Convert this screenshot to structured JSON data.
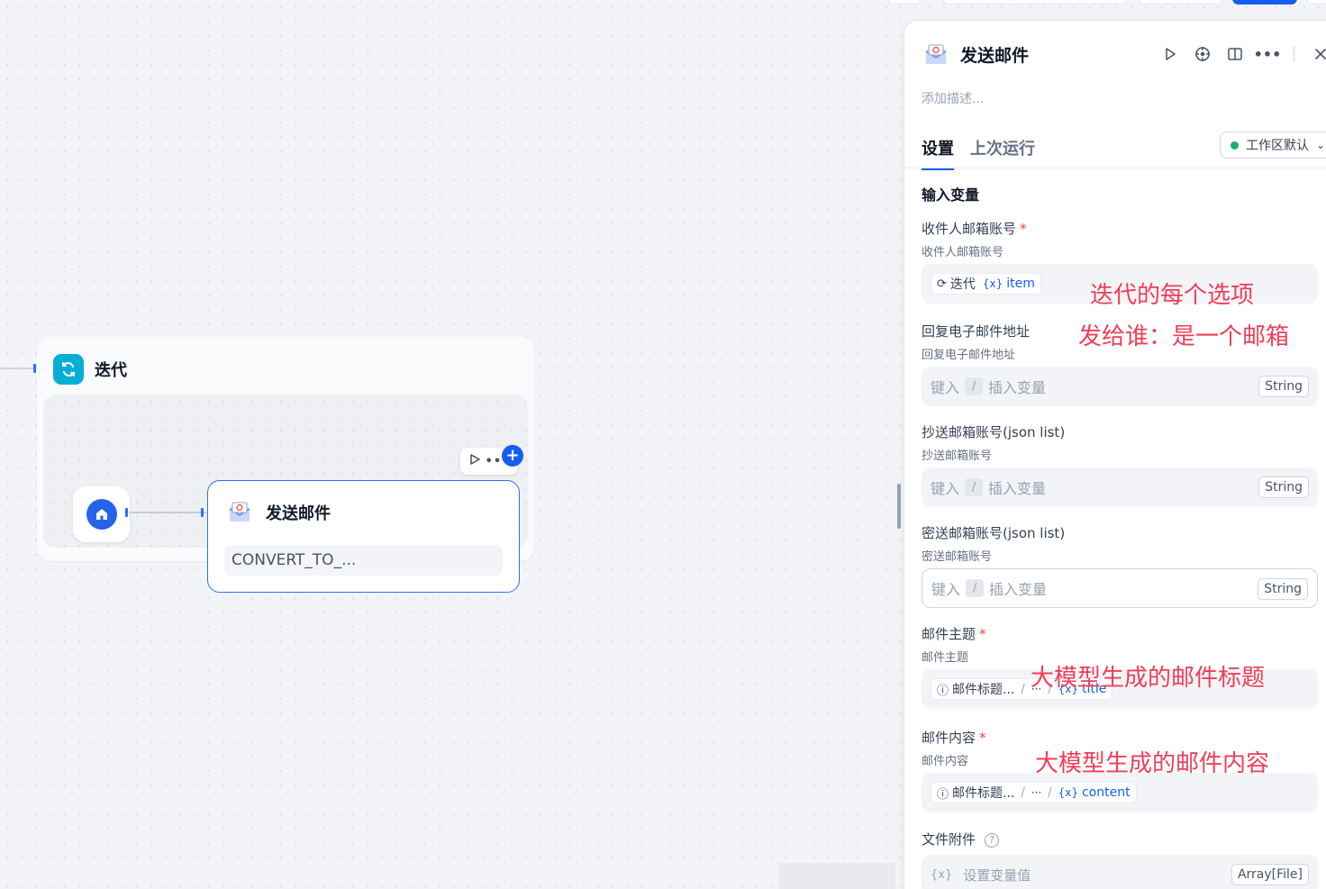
{
  "canvas": {
    "iteration_node": {
      "title": "迭代"
    },
    "mail_node": {
      "title": "发送邮件",
      "field_value": "CONVERT_TO_..."
    },
    "node_toolbar": {
      "run_icon": "play-icon",
      "more_icon": "more-icon"
    }
  },
  "panel": {
    "title": "发送邮件",
    "description_placeholder": "添加描述...",
    "tabs": [
      {
        "label": "设置",
        "active": true
      },
      {
        "label": "上次运行",
        "active": false
      }
    ],
    "workspace_select": "工作区默认",
    "section_title": "输入变量",
    "fields": {
      "recipient": {
        "label": "收件人邮箱账号",
        "required": "*",
        "sub": "收件人邮箱账号",
        "chip_node": "迭代",
        "chip_var": "item"
      },
      "reply_to": {
        "label": "回复电子邮件地址",
        "sub": "回复电子邮件地址",
        "placeholder_a": "键入",
        "placeholder_slash": "/",
        "placeholder_b": "插入变量",
        "type": "String"
      },
      "cc": {
        "label": "抄送邮箱账号(json list)",
        "sub": "抄送邮箱账号",
        "placeholder_a": "键入",
        "placeholder_slash": "/",
        "placeholder_b": "插入变量",
        "type": "String"
      },
      "bcc": {
        "label": "密送邮箱账号(json list)",
        "sub": "密送邮箱账号",
        "placeholder_a": "键入",
        "placeholder_slash": "/",
        "placeholder_b": "插入变量",
        "type": "String"
      },
      "subject": {
        "label": "邮件主题",
        "required": "*",
        "sub": "邮件主题",
        "chip_node": "邮件标题...",
        "chip_sep": "/",
        "chip_mid": "···",
        "chip_var": "title"
      },
      "content": {
        "label": "邮件内容",
        "required": "*",
        "sub": "邮件内容",
        "chip_node": "邮件标题...",
        "chip_sep": "/",
        "chip_mid": "···",
        "chip_var": "content"
      },
      "attachment": {
        "label": "文件附件",
        "help": "?",
        "placeholder": "设置变量值",
        "type": "Array[File]"
      }
    },
    "var_prefix": "{x}"
  },
  "annotations": [
    "迭代的每个选项",
    "发给谁：是一个邮箱",
    "大模型生成的邮件标题",
    "大模型生成的邮件内容"
  ],
  "colors": {
    "accent": "#155eef",
    "iteration": "#06aed4",
    "annotation": "#f03e58",
    "status_green": "#17b26a"
  }
}
